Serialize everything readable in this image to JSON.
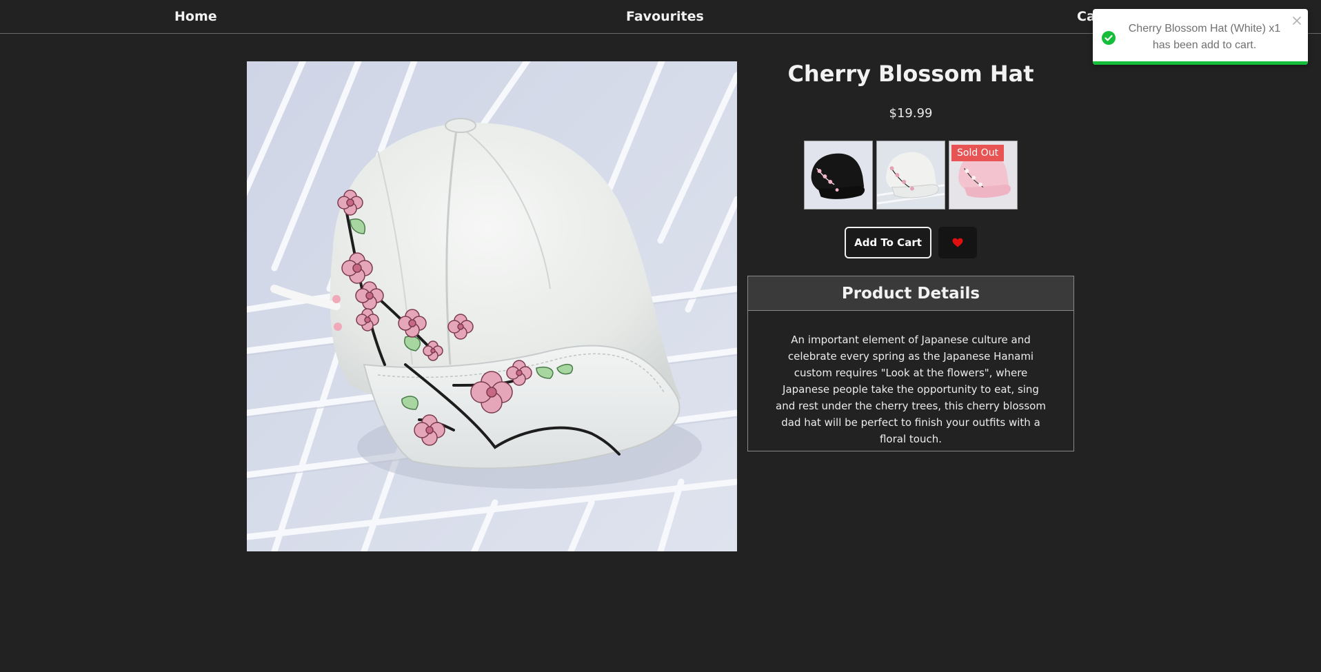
{
  "nav": {
    "home": "Home",
    "favourites": "Favourites",
    "cart": "Cart"
  },
  "product": {
    "title": "Cherry Blossom Hat",
    "price": "$19.99",
    "variants": [
      {
        "color": "Black",
        "sold_out": false
      },
      {
        "color": "White",
        "sold_out": false
      },
      {
        "color": "Pink",
        "sold_out": true,
        "badge": "Sold Out"
      }
    ],
    "add_to_cart": "Add To Cart",
    "details_heading": "Product Details",
    "description": "An important element of Japanese culture and celebrate every spring as the Japanese Hanami custom requires \"Look at the flowers\", where Japanese people take the opportunity to eat, sing and rest under the cherry trees, this cherry blossom dad hat will be perfect to finish your outfits with a floral touch."
  },
  "toast": {
    "message": "Cherry Blossom Hat (White) x1 has been add to cart.",
    "status": "success",
    "accent_color": "#16bd3a"
  },
  "icons": {
    "cart": "cart-icon",
    "favourite": "heart-icon",
    "success": "check-circle-icon",
    "close": "close-icon"
  },
  "colors": {
    "background": "#222222",
    "sold_out_badge": "#e85454",
    "heart": "#e01010"
  }
}
